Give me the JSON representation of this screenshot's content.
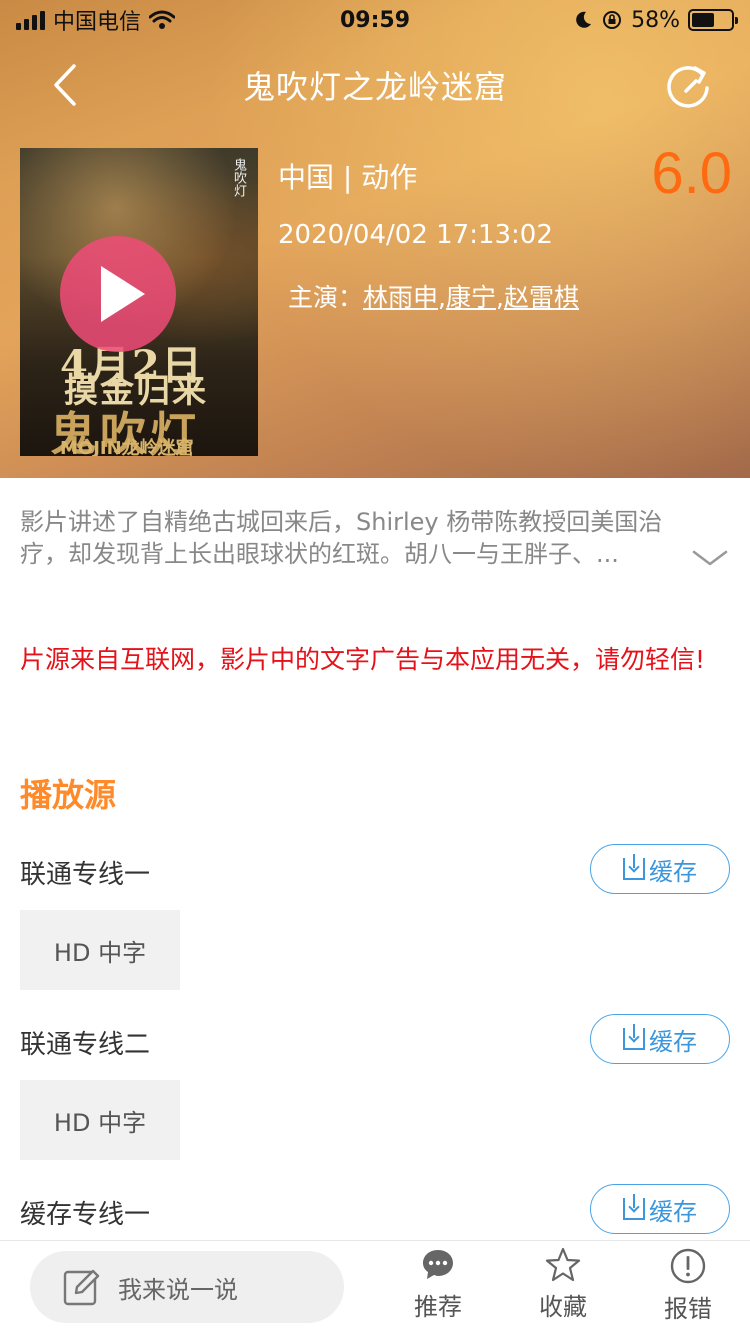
{
  "status_bar": {
    "carrier": "中国电信",
    "time": "09:59",
    "battery": "58%",
    "battery_level": 0.58
  },
  "nav": {
    "title": "鬼吹灯之龙岭迷窟",
    "back_icon": "chevron-left-icon",
    "share_icon": "share-refresh-icon"
  },
  "movie": {
    "poster": {
      "date_text": "4月2日",
      "slogan": "摸金归来",
      "title": "鬼吹灯",
      "subtitle": "MOJIN龙岭迷窟"
    },
    "genre": "中国 | 动作",
    "date": "2020/04/02 17:13:02",
    "cast_label": "主演：",
    "cast": [
      "林雨申",
      "康宁",
      "赵雷棋"
    ],
    "score": "6.0",
    "description": "影片讲述了自精绝古城回来后，Shirley 杨带陈教授回美国治疗，却发现背上长出眼球状的红斑。胡八一与王胖子、..."
  },
  "notice": "片源来自互联网，影片中的文字广告与本应用无关，请勿轻信!",
  "sources": {
    "title": "播放源",
    "lines": [
      {
        "name": "联通专线一",
        "cache": "缓存",
        "episodes": [
          "HD 中字"
        ]
      },
      {
        "name": "联通专线二",
        "cache": "缓存",
        "episodes": [
          "HD 中字"
        ]
      },
      {
        "name": "缓存专线一",
        "cache": "缓存",
        "episodes": []
      }
    ]
  },
  "bottom_bar": {
    "comment_placeholder": "我来说一说",
    "tabs": [
      {
        "label": "推荐",
        "icon": "chat-bubble-icon"
      },
      {
        "label": "收藏",
        "icon": "star-icon"
      },
      {
        "label": "报错",
        "icon": "alert-circle-icon"
      }
    ]
  },
  "colors": {
    "accent": "#ff8a2a",
    "score": "#ff6a10",
    "notice": "#e5121a",
    "cache_button": "#3b96dc"
  }
}
